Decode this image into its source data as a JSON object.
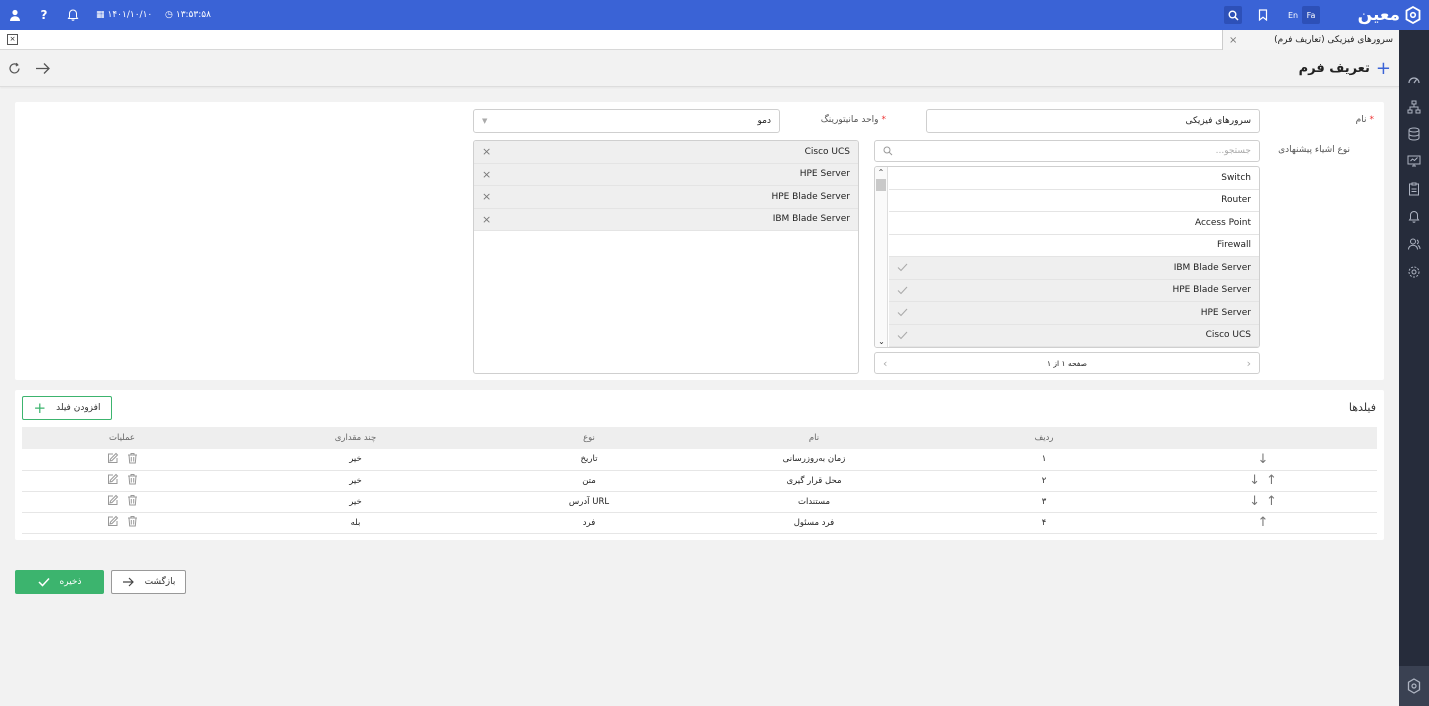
{
  "topbar": {
    "brand": "معین",
    "lang_fa": "Fa",
    "lang_en": "En",
    "date": "۱۴۰۱/۱۰/۱۰",
    "time": "۱۳:۵۳:۵۸",
    "accent": "#3a63d6"
  },
  "tab": {
    "label": "سرورهای فیزیکی (تعاریف فرم)"
  },
  "page": {
    "title": "تعریف فرم"
  },
  "form": {
    "name_label": "نام",
    "name_value": "سرورهای فیزیکی",
    "unit_label": "واحد مانیتورینگ",
    "unit_value": "دمو",
    "types_label": "نوع اشیاء پیشنهادی",
    "search_placeholder": "جستجو...",
    "available_items": [
      {
        "label": "Switch",
        "selected": false
      },
      {
        "label": "Router",
        "selected": false
      },
      {
        "label": "Access Point",
        "selected": false
      },
      {
        "label": "Firewall",
        "selected": false
      },
      {
        "label": "IBM Blade Server",
        "selected": true
      },
      {
        "label": "HPE Blade Server",
        "selected": true
      },
      {
        "label": "HPE Server",
        "selected": true
      },
      {
        "label": "Cisco UCS",
        "selected": true
      }
    ],
    "pagination": "صفحه ۱ از ۱",
    "selected_items": [
      "Cisco UCS",
      "HPE Server",
      "HPE Blade Server",
      "IBM Blade Server"
    ]
  },
  "fields": {
    "title": "فیلدها",
    "add_button": "افزودن فیلد",
    "columns": [
      "ردیف",
      "نام",
      "نوع",
      "چند مقداری",
      "عملیات"
    ],
    "rows": [
      {
        "index": "۱",
        "name": "زمان به‌روزرسانی",
        "type": "تاریخ",
        "multi": "خیر",
        "up": false,
        "down": true
      },
      {
        "index": "۲",
        "name": "محل قرار گیری",
        "type": "متن",
        "multi": "خیر",
        "up": true,
        "down": true
      },
      {
        "index": "۳",
        "name": "مستندات",
        "type": "آدرس URL",
        "multi": "خیر",
        "up": true,
        "down": true
      },
      {
        "index": "۴",
        "name": "فرد مسئول",
        "type": "فرد",
        "multi": "بله",
        "up": true,
        "down": false
      }
    ]
  },
  "actions": {
    "back": "بازگشت",
    "save": "ذخیره",
    "save_color": "#3cb46e"
  }
}
